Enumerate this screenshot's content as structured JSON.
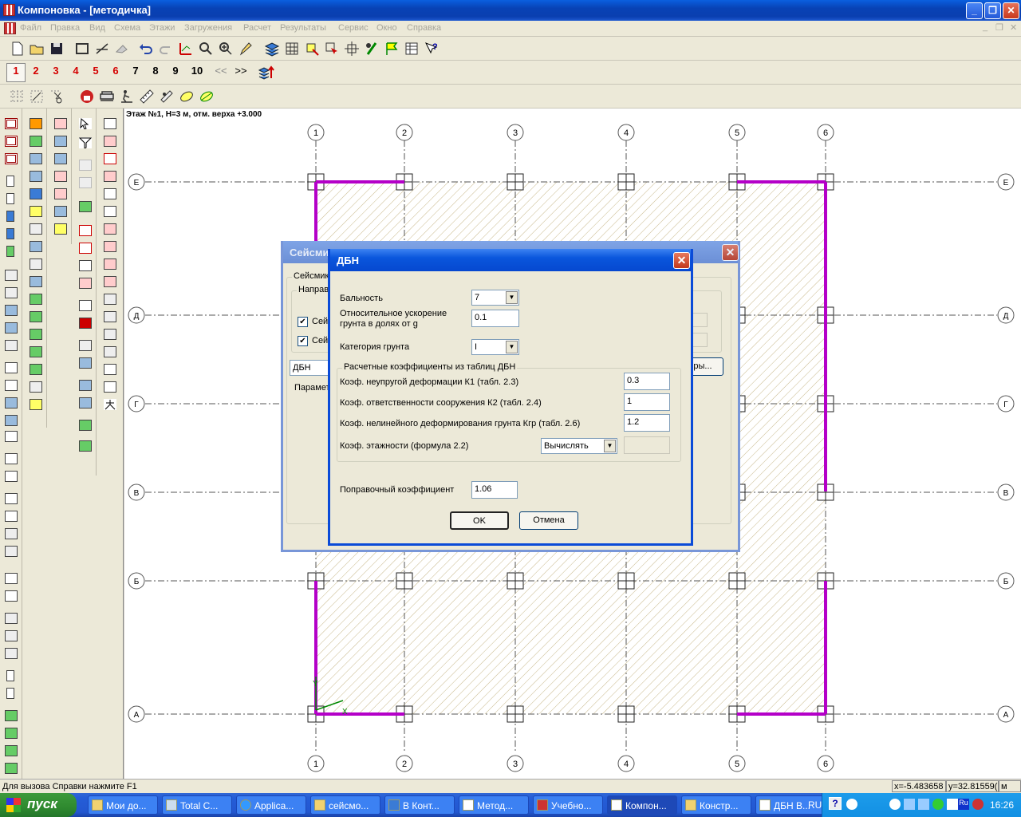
{
  "window": {
    "title": "Компоновка - [методичка]"
  },
  "menu": [
    "Файл",
    "Правка",
    "Вид",
    "Схема",
    "Этажи",
    "Загружения",
    "Расчет",
    "Результаты",
    "Сервис",
    "Окно",
    "Справка"
  ],
  "floor_numbers": [
    "1",
    "2",
    "3",
    "4",
    "5",
    "6",
    "7",
    "8",
    "9",
    "10"
  ],
  "floor_nav": {
    "prev": "<<",
    "next": ">>"
  },
  "canvas": {
    "floor_label": "Этаж №1, Н=3 м, отм. верха +3.000",
    "axis_columns": [
      "1",
      "2",
      "3",
      "4",
      "5",
      "6"
    ],
    "axis_rows": [
      "Е",
      "Д",
      "Г",
      "В",
      "Б",
      "А"
    ],
    "axis_markers": [
      "Y",
      "X"
    ]
  },
  "back_dialog": {
    "title": "Сейсмик",
    "group_label": "Сейсмик",
    "subgroup_label": "Направ",
    "check1": "Сейс",
    "check2": "Сейс",
    "checkmark": "✔",
    "norm_value": "ДБН",
    "params_label": "Парамет",
    "params_btn": "ры..."
  },
  "dialog": {
    "title": "ДБН",
    "close_glyph": "✕",
    "intensity_label": "Бальность",
    "intensity_value": "7",
    "accel_label_1": "Относительное ускорение",
    "accel_label_2": "грунта в долях от g",
    "accel_value": "0.1",
    "soil_label": "Категория грунта",
    "soil_value": "I",
    "group_title": "Расчетные коэффициенты из таблиц ДБН",
    "k1_label": "Коэф. неупругой деформации  К1 (табл. 2.3)",
    "k1_value": "0.3",
    "k2_label": "Коэф. ответственности сооружения  К2 (табл. 2.4)",
    "k2_value": "1",
    "kgr_label": "Коэф. нелинейного деформирования грунта Кгр (табл. 2.6)",
    "kgr_value": "1.2",
    "floors_label": "Коэф. этажности (формула 2.2)",
    "floors_mode": "Вычислять",
    "floors_value": "",
    "correction_label": "Поправочный коэффициент",
    "correction_value": "1.06",
    "ok": "OK",
    "cancel": "Отмена"
  },
  "status": {
    "help": "Для вызова Справки нажмите F1",
    "x": "x=-5.483658",
    "y": "y=32.81559(",
    "m": "м"
  },
  "taskbar": {
    "start": "пуск",
    "tasks": [
      "Мои до...",
      "Total C...",
      "Applica...",
      "сейсмо...",
      "В Конт...",
      "Метод...",
      "Учебно...",
      "Компон...",
      "Констр...",
      "ДБН В..."
    ],
    "lang": "RU",
    "help_glyph": "?",
    "tray_glyph": "Ru",
    "clock": "16:26"
  },
  "colors": {
    "accent": "#0a56dc",
    "frame": "#b400c8",
    "hatch": "#c8b88a",
    "floor_active": "#d40000"
  }
}
